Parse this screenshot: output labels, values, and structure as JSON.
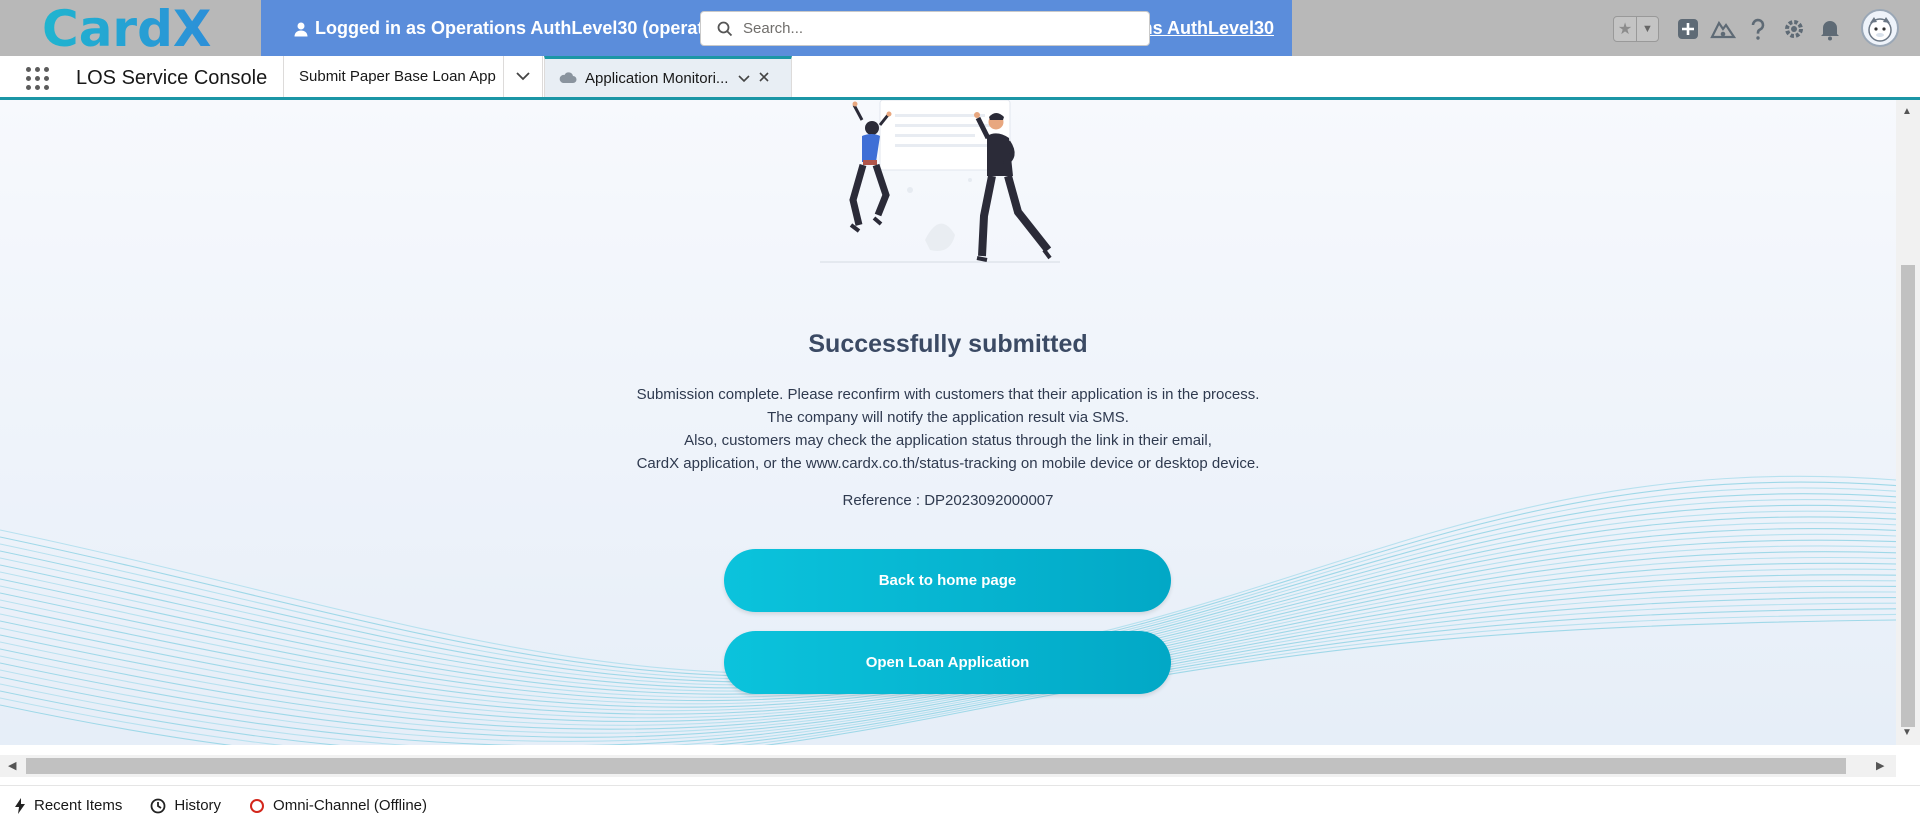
{
  "header": {
    "logo_text": "CardX",
    "banner_left": "Logged in as Operations AuthLevel30 (operations",
    "banner_right": "ns AuthLevel30",
    "search_placeholder": "Search..."
  },
  "nav": {
    "app_name": "LOS Service Console",
    "tabs": [
      {
        "label": "Submit Paper Base Loan App"
      },
      {
        "label": "Application Monitori..."
      }
    ]
  },
  "main": {
    "title": "Successfully submitted",
    "message_lines": [
      "Submission complete. Please reconfirm with customers that their application is in the process.",
      "The company will notify the application result via SMS.",
      "Also, customers may check the application status through the link in their email,",
      "CardX application, or the www.cardx.co.th/status-tracking on mobile device or desktop device."
    ],
    "reference": "Reference : DP2023092000007",
    "buttons": {
      "back_home": "Back to home page",
      "open_loan": "Open Loan Application"
    }
  },
  "utility_bar": {
    "recent_items": "Recent Items",
    "history": "History",
    "omni_channel": "Omni-Channel (Offline)"
  },
  "colors": {
    "brand_teal": "#1b96a6",
    "banner_blue": "#5b8ddb",
    "button_cyan": "#0bc3dc",
    "omni_offline_red": "#d3271c"
  }
}
